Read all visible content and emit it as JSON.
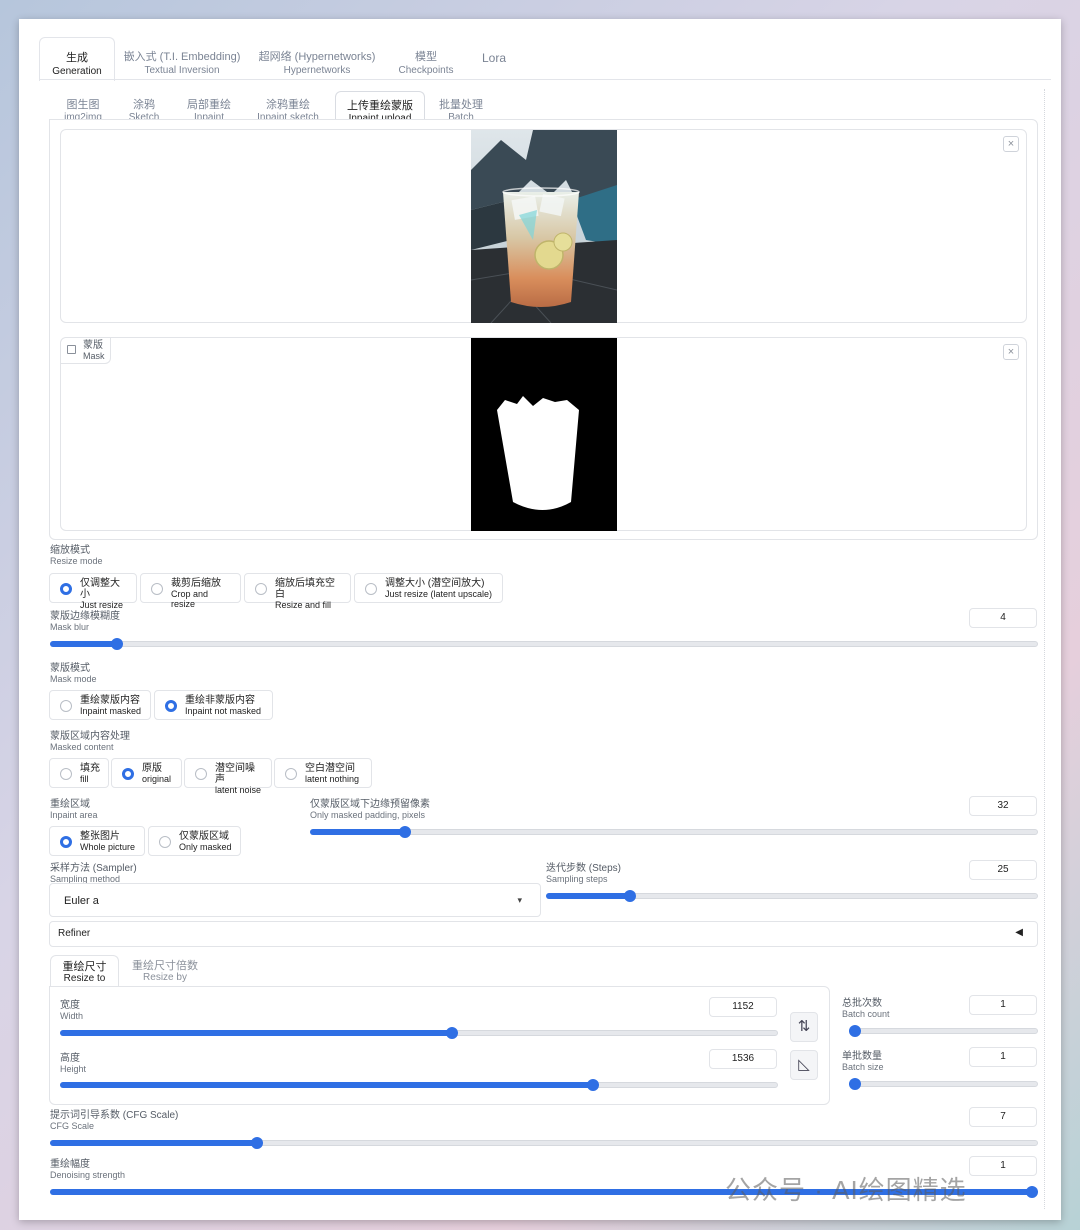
{
  "top_tabs": [
    {
      "zh": "生成",
      "en": "Generation"
    },
    {
      "zh": "嵌入式 (T.I. Embedding)",
      "en": "Textual Inversion"
    },
    {
      "zh": "超网络 (Hypernetworks)",
      "en": "Hypernetworks"
    },
    {
      "zh": "模型",
      "en": "Checkpoints"
    },
    {
      "zh": "Lora",
      "en": ""
    }
  ],
  "sub_tabs": [
    {
      "zh": "图生图",
      "en": "img2img"
    },
    {
      "zh": "涂鸦",
      "en": "Sketch"
    },
    {
      "zh": "局部重绘",
      "en": "Inpaint"
    },
    {
      "zh": "涂鸦重绘",
      "en": "Inpaint sketch"
    },
    {
      "zh": "上传重绘蒙版",
      "en": "Inpaint upload"
    },
    {
      "zh": "批量处理",
      "en": "Batch"
    }
  ],
  "image_panel": {
    "close": "×"
  },
  "mask_panel": {
    "label_zh": "蒙版",
    "label_en": "Mask",
    "close": "×"
  },
  "resize_mode": {
    "label_zh": "缩放模式",
    "label_en": "Resize mode",
    "options": [
      {
        "zh": "仅调整大小",
        "en": "Just resize"
      },
      {
        "zh": "裁剪后缩放",
        "en": "Crop and resize"
      },
      {
        "zh": "缩放后填充空白",
        "en": "Resize and fill"
      },
      {
        "zh": "调整大小 (潜空间放大)",
        "en": "Just resize (latent upscale)"
      }
    ],
    "selected": 0
  },
  "mask_blur": {
    "label_zh": "蒙版边缘模糊度",
    "label_en": "Mask blur",
    "value": "4",
    "fraction": 0.068
  },
  "mask_mode": {
    "label_zh": "蒙版模式",
    "label_en": "Mask mode",
    "options": [
      {
        "zh": "重绘蒙版内容",
        "en": "Inpaint masked"
      },
      {
        "zh": "重绘非蒙版内容",
        "en": "Inpaint not masked"
      }
    ],
    "selected": 1
  },
  "masked_content": {
    "label_zh": "蒙版区域内容处理",
    "label_en": "Masked content",
    "options": [
      {
        "zh": "填充",
        "en": "fill"
      },
      {
        "zh": "原版",
        "en": "original"
      },
      {
        "zh": "潜空间噪声",
        "en": "latent noise"
      },
      {
        "zh": "空白潜空间",
        "en": "latent nothing"
      }
    ],
    "selected": 1
  },
  "inpaint_area": {
    "label_zh": "重绘区域",
    "label_en": "Inpaint area",
    "options": [
      {
        "zh": "整张图片",
        "en": "Whole picture"
      },
      {
        "zh": "仅蒙版区域",
        "en": "Only masked"
      }
    ],
    "selected": 0
  },
  "masked_padding": {
    "label_zh": "仅蒙版区域下边缘预留像素",
    "label_en": "Only masked padding, pixels",
    "value": "32",
    "fraction": 0.13
  },
  "sampler": {
    "label_zh": "采样方法 (Sampler)",
    "label_en": "Sampling method",
    "value": "Euler a",
    "caret": "▾"
  },
  "steps": {
    "label_zh": "迭代步数 (Steps)",
    "label_en": "Sampling steps",
    "value": "25",
    "fraction": 0.17
  },
  "refiner": {
    "label": "Refiner",
    "arrow": "◀"
  },
  "size_tabs": [
    {
      "zh": "重绘尺寸",
      "en": "Resize to"
    },
    {
      "zh": "重绘尺寸倍数",
      "en": "Resize by"
    }
  ],
  "width": {
    "label_zh": "宽度",
    "label_en": "Width",
    "value": "1152",
    "fraction": 0.546
  },
  "height": {
    "label_zh": "高度",
    "label_en": "Height",
    "value": "1536",
    "fraction": 0.742
  },
  "swap_icon": "⇅",
  "ratio_icon": "◺",
  "batch_count": {
    "label_zh": "总批次数",
    "label_en": "Batch count",
    "value": "1",
    "fraction": 0.0
  },
  "batch_size": {
    "label_zh": "单批数量",
    "label_en": "Batch size",
    "value": "1",
    "fraction": 0.0
  },
  "cfg": {
    "label_zh": "提示词引导系数 (CFG Scale)",
    "label_en": "CFG Scale",
    "value": "7",
    "fraction": 0.21
  },
  "denoise": {
    "label_zh": "重绘幅度",
    "label_en": "Denoising strength",
    "value": "1",
    "fraction": 1.0
  },
  "watermark": "公众号 · AI绘图精选",
  "colors": {
    "accent": "#2f6fe4"
  }
}
